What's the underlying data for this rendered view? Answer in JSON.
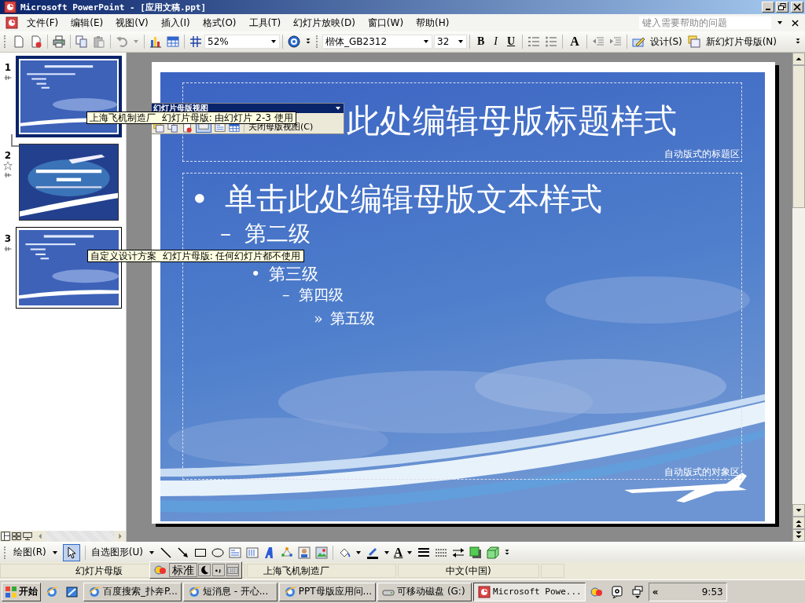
{
  "window": {
    "title": "Microsoft PowerPoint - [应用文稿.ppt]"
  },
  "menu": [
    "文件(F)",
    "编辑(E)",
    "视图(V)",
    "插入(I)",
    "格式(O)",
    "工具(T)",
    "幻灯片放映(D)",
    "窗口(W)",
    "帮助(H)"
  ],
  "help_box": {
    "placeholder": "键入需要帮助的问题"
  },
  "toolbar": {
    "zoom": "52%",
    "font": "楷体_GB2312",
    "size": "32",
    "format_buttons": [
      {
        "label": "B",
        "kind": "bold"
      },
      {
        "label": "I",
        "kind": "italic"
      },
      {
        "label": "U",
        "kind": "underline"
      }
    ],
    "grow_font": "A",
    "design_button": "设计(S)",
    "new_master_button": "新幻灯片母版(N)"
  },
  "slides": [
    {
      "number": "1",
      "kind": "master",
      "selected": true
    },
    {
      "number": "2",
      "kind": "title",
      "selected": false
    },
    {
      "number": "3",
      "kind": "master",
      "selected": false
    }
  ],
  "tooltips": [
    "上海飞机制造厂  幻灯片母版: 由幻灯片 2-3 使用",
    "自定义设计方案  幻灯片母版: 任何幻灯片都不使用"
  ],
  "master_toolbar": {
    "title": "幻灯片母版视图",
    "close_button": "关闭母版视图(C)"
  },
  "slide": {
    "title": "此处编辑母版标题样式",
    "title_area_label": "自动版式的标题区",
    "levels": [
      {
        "bullet": "•",
        "text": "单击此处编辑母版文本样式",
        "children": [
          {
            "bullet": "–",
            "text": "第二级",
            "children": [
              {
                "bullet": "•",
                "text": "第三级",
                "children": [
                  {
                    "bullet": "–",
                    "text": "第四级",
                    "children": [
                      {
                        "bullet": "»",
                        "text": "第五级"
                      }
                    ]
                  }
                ]
              }
            ]
          }
        ]
      }
    ],
    "object_area_label": "自动版式的对象区"
  },
  "drawing_toolbar": {
    "draw_menu": "绘图(R)",
    "autoshapes_menu": "自选图形(U)",
    "font_color": "A"
  },
  "status_bar": [
    "幻灯片母版",
    "上海飞机制造厂",
    "中文(中国)"
  ],
  "ime_bar": {
    "mode": "标准"
  },
  "taskbar": {
    "start": "开始",
    "tasks": [
      {
        "label": "百度搜索_扑奔P...",
        "kind": "browser",
        "selected": false
      },
      {
        "label": "短消息 - 开心...",
        "kind": "browser",
        "selected": false
      },
      {
        "label": "PPT母版应用问...",
        "kind": "browser",
        "selected": false
      },
      {
        "label": "可移动磁盘 (G:)",
        "kind": "drive",
        "selected": false
      },
      {
        "label": "Microsoft Powe...",
        "kind": "powerpoint",
        "selected": true
      }
    ],
    "tray_expand": "«",
    "clock": "9:53"
  }
}
